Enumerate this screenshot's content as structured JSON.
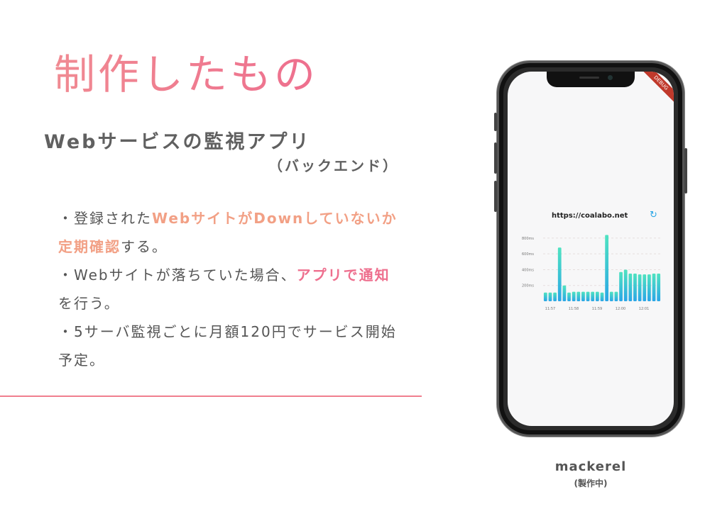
{
  "slide": {
    "title": "制作したもの",
    "subtitle": "Webサービスの監視アプリ",
    "subtitle_sub": "（バックエンド）",
    "bullets": [
      {
        "parts": [
          {
            "text": "・登録された",
            "style": "normal"
          },
          {
            "text": "WebサイトがDownしていないか定期確認",
            "style": "hl"
          },
          {
            "text": "する。",
            "style": "normal"
          }
        ]
      },
      {
        "parts": [
          {
            "text": "・Webサイトが落ちていた場合、",
            "style": "normal"
          },
          {
            "text": "アプリで通知",
            "style": "hl2"
          },
          {
            "text": "を行う。",
            "style": "normal"
          }
        ]
      },
      {
        "parts": [
          {
            "text": "・5サーバ監視ごとに月額120円でサービス開始予定。",
            "style": "normal"
          }
        ]
      }
    ],
    "caption_name": "mackerel",
    "caption_sub": "(製作中)"
  },
  "phone": {
    "debug_ribbon": "DEBUG",
    "url": "https://coalabo.net",
    "refresh_icon": "refresh-icon"
  },
  "colors": {
    "title_gradient_start": "#f08a92",
    "title_gradient_end": "#ee6f8e",
    "highlight_orange": "#f2a085",
    "highlight_pink": "#ee6f8e",
    "divider": "#f07f8f",
    "bar_start": "#4fe3c1",
    "bar_end": "#2aa6e6"
  },
  "chart_data": {
    "type": "bar",
    "y_tick_labels": [
      "800ms",
      "600ms",
      "400ms",
      "200ms"
    ],
    "y_ticks": [
      800,
      600,
      400,
      200
    ],
    "ylim": [
      0,
      880
    ],
    "x_tick_labels": [
      "11:57",
      "11:58",
      "11:59",
      "12:00",
      "12:01"
    ],
    "values": [
      110,
      110,
      110,
      680,
      200,
      110,
      120,
      120,
      120,
      120,
      120,
      120,
      110,
      840,
      120,
      120,
      370,
      400,
      350,
      350,
      340,
      340,
      340,
      350,
      350
    ]
  }
}
